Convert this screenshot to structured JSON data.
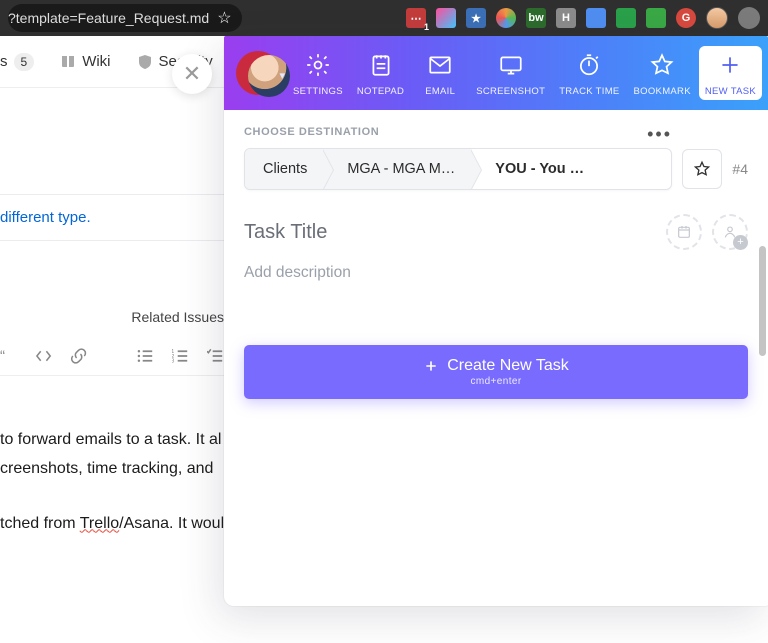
{
  "browser": {
    "url_fragment": "?template=Feature_Request.md",
    "ext_labels": [
      "...",
      "S",
      "★",
      "✦",
      "bw",
      "H",
      "▭",
      "▯",
      "▭",
      "G"
    ]
  },
  "page": {
    "tab_count": "5",
    "tab_wiki": "Wiki",
    "tab_security": "Security",
    "link_text": "different type.",
    "related": "Related Issues",
    "body1": "to forward emails to a task. It al",
    "body2": "creenshots, time tracking, and",
    "body3a": "tched from ",
    "body3b": "Trello",
    "body3c": "/Asana. It would be great"
  },
  "panel": {
    "header": {
      "settings": "SETTINGS",
      "notepad": "NOTEPAD",
      "email": "EMAIL",
      "screenshot": "SCREENSHOT",
      "tracktime": "TRACK TIME",
      "bookmark": "BOOKMARK",
      "newtask": "NEW TASK"
    },
    "choose": "CHOOSE DESTINATION",
    "crumbs": {
      "c1": "Clients",
      "c2": "MGA - MGA M…",
      "c3": "YOU - You …"
    },
    "hash": "#4",
    "title_placeholder": "Task Title",
    "desc_placeholder": "Add description",
    "create": "Create New Task",
    "create_sub": "cmd+enter"
  }
}
